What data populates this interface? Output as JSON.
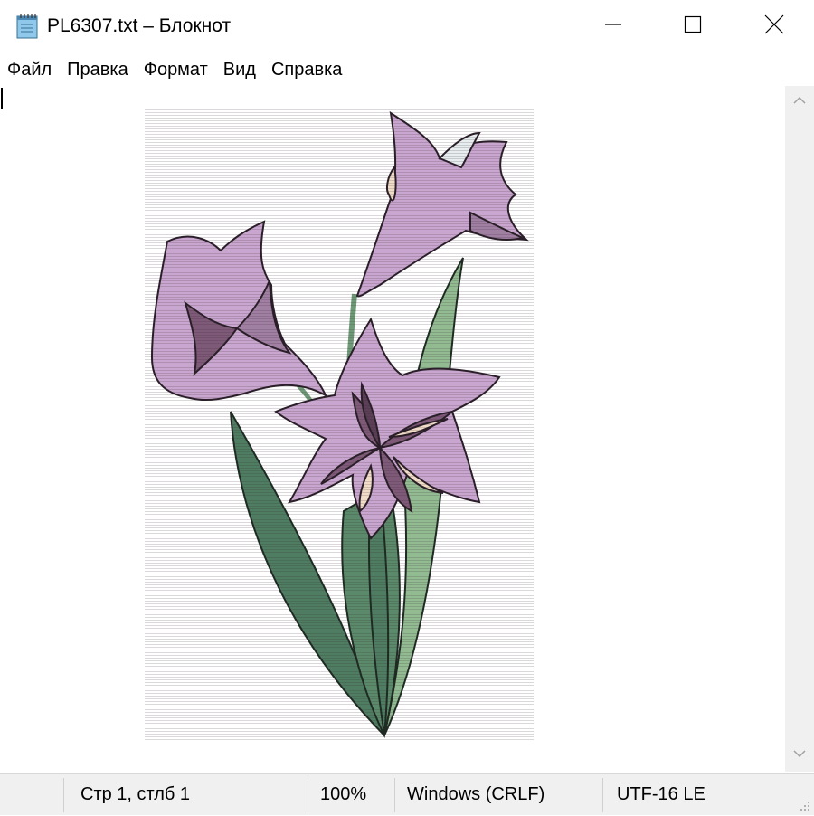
{
  "window": {
    "title": "PL6307.txt – Блокнот",
    "icon": "notepad-icon",
    "controls": [
      "minimize-icon",
      "maximize-icon",
      "close-icon"
    ]
  },
  "menu": {
    "items": [
      {
        "label": "Файл"
      },
      {
        "label": "Правка"
      },
      {
        "label": "Формат"
      },
      {
        "label": "Вид"
      },
      {
        "label": "Справка"
      }
    ]
  },
  "status": {
    "position": "Стр 1, стлб 1",
    "zoom": "100%",
    "line_endings": "Windows (CRLF)",
    "encoding": "UTF-16 LE"
  },
  "colors": {
    "petal": "#c9a6cf",
    "petal_dark": "#7e5a78",
    "leaf": "#4f7d62",
    "leaf_light": "#93bb91",
    "cream": "#f1dcc8",
    "status_bg": "#f0f0f0"
  }
}
